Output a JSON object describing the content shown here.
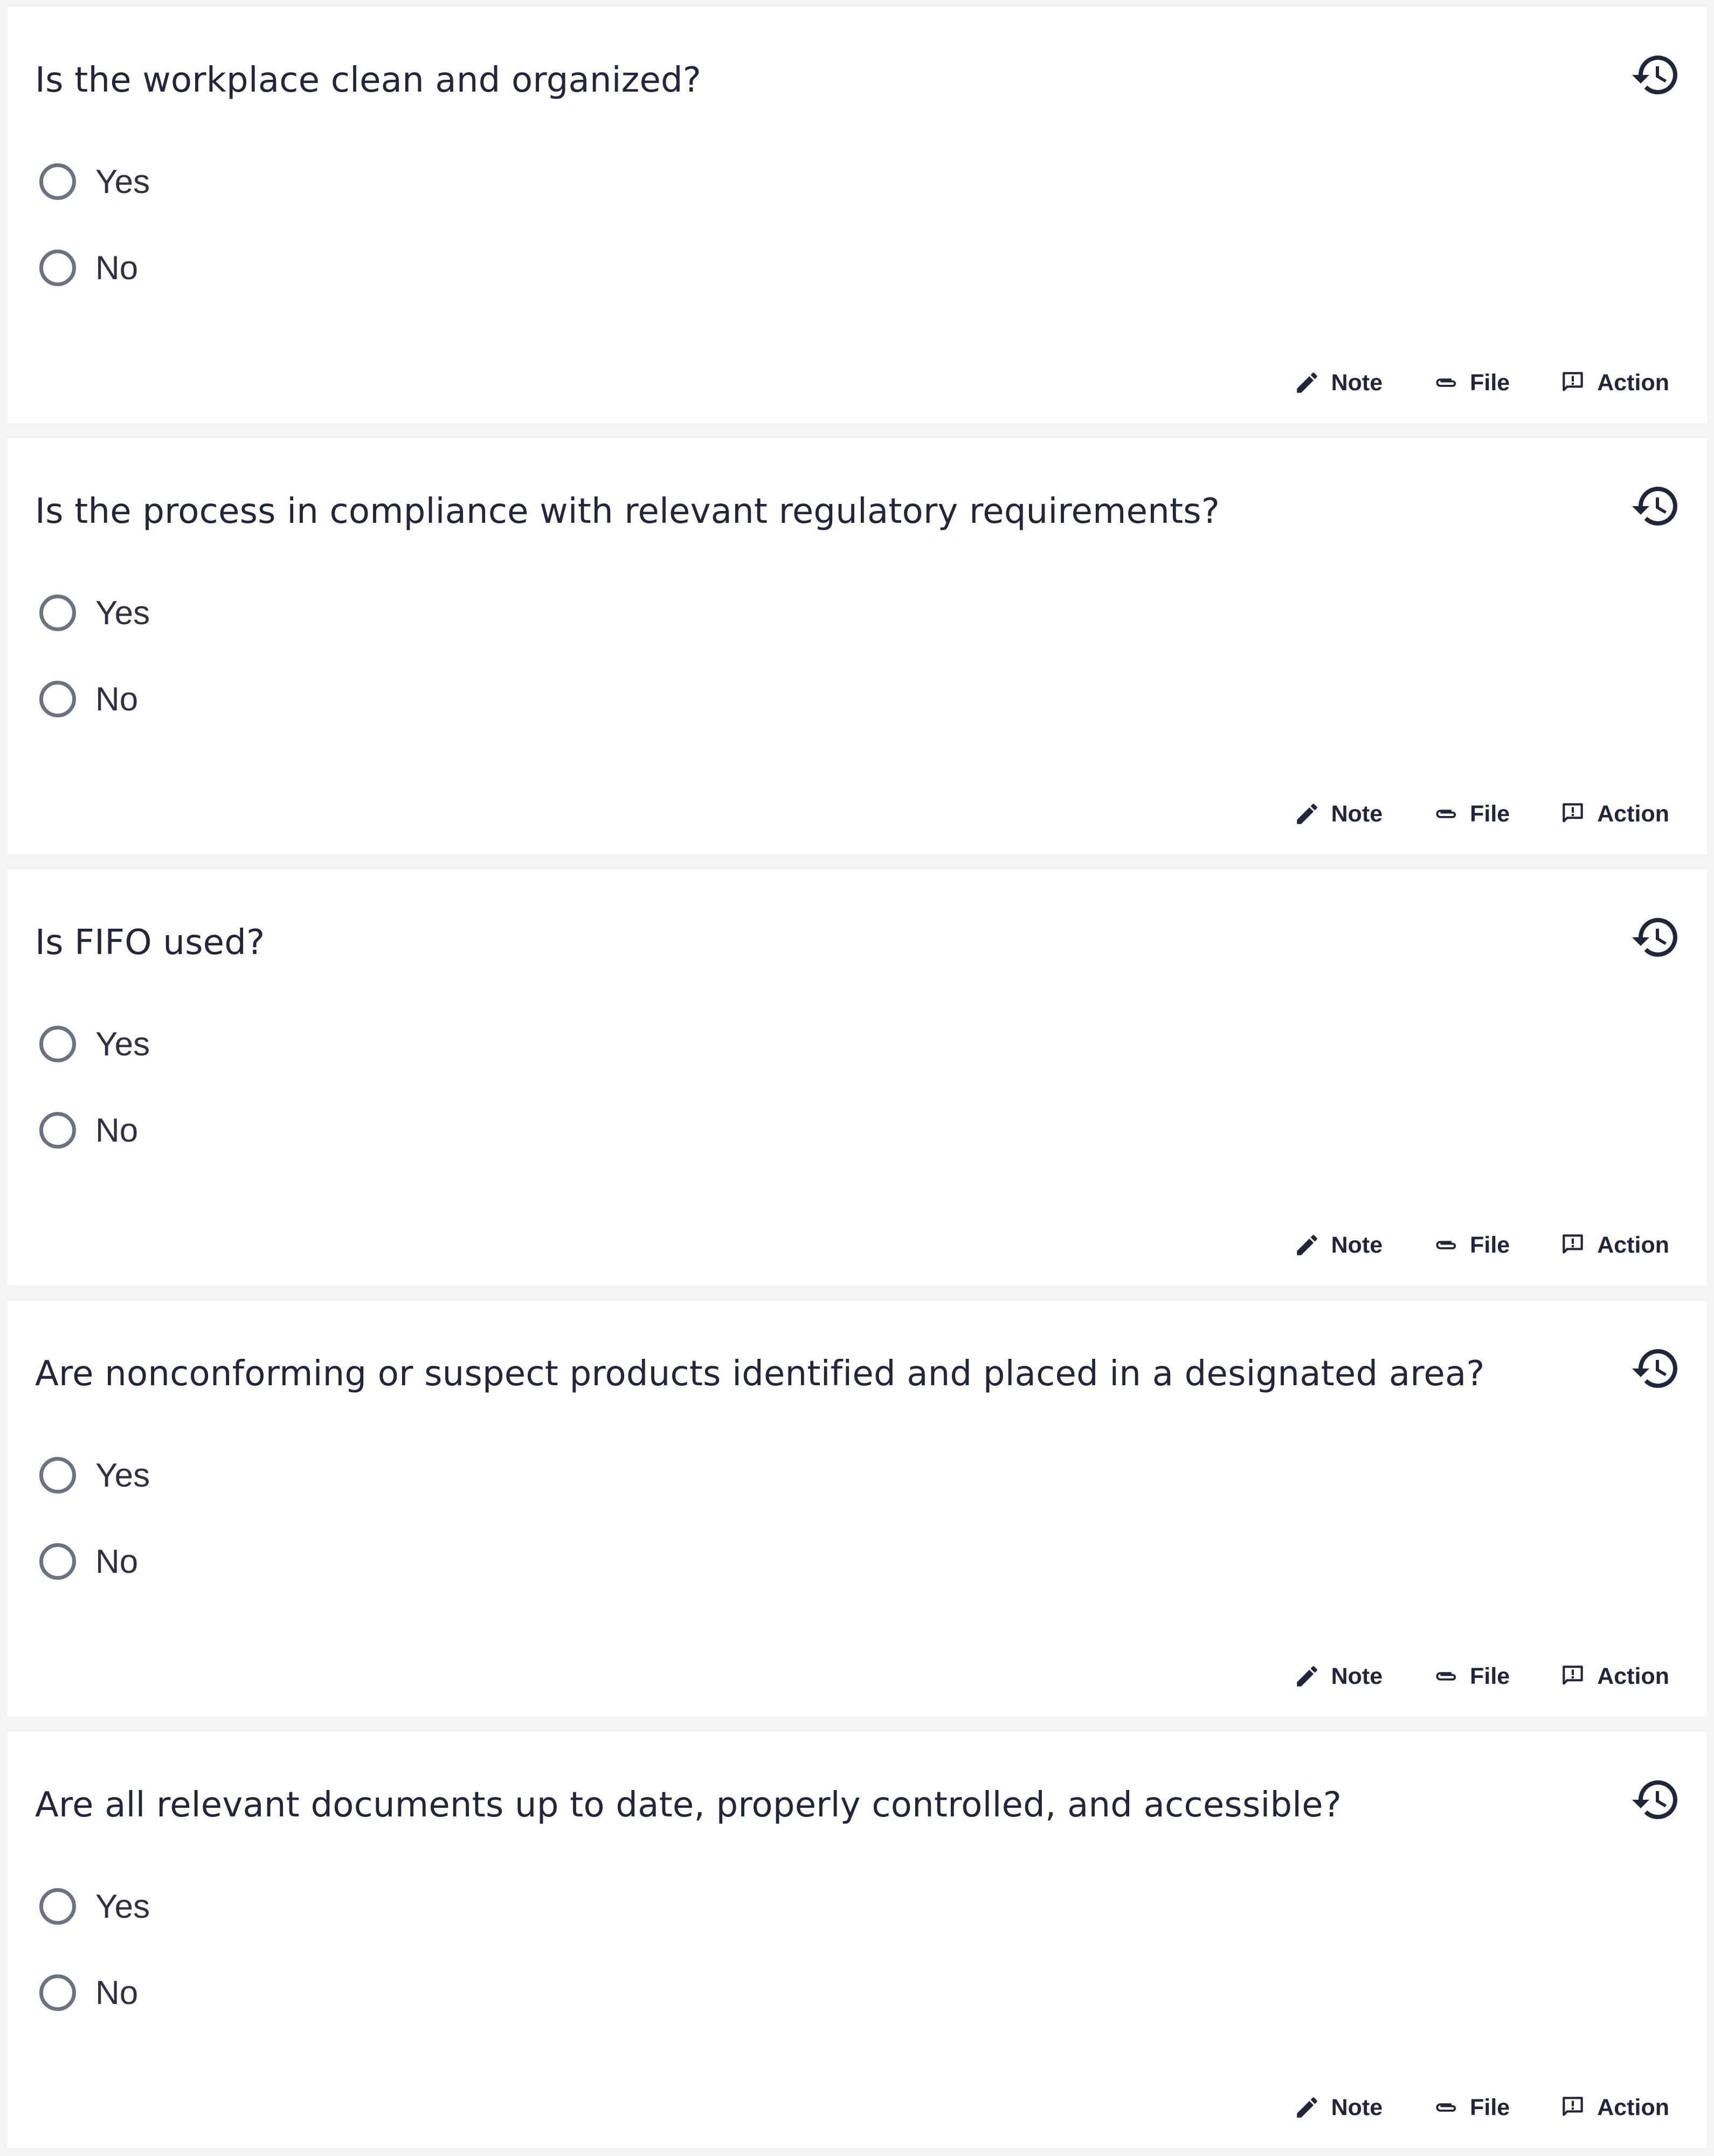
{
  "questions": [
    {
      "text": "Is the workplace clean and organized?",
      "options": [
        "Yes",
        "No"
      ],
      "actions": {
        "note": "Note",
        "file": "File",
        "action": "Action"
      }
    },
    {
      "text": "Is the process in compliance with relevant regulatory requirements?",
      "options": [
        "Yes",
        "No"
      ],
      "actions": {
        "note": "Note",
        "file": "File",
        "action": "Action"
      }
    },
    {
      "text": "Is FIFO used?",
      "options": [
        "Yes",
        "No"
      ],
      "actions": {
        "note": "Note",
        "file": "File",
        "action": "Action"
      }
    },
    {
      "text": "Are nonconforming or suspect products identified and placed in a designated area?",
      "options": [
        "Yes",
        "No"
      ],
      "actions": {
        "note": "Note",
        "file": "File",
        "action": "Action"
      }
    },
    {
      "text": "Are all relevant documents up to date, properly controlled, and accessible?",
      "options": [
        "Yes",
        "No"
      ],
      "actions": {
        "note": "Note",
        "file": "File",
        "action": "Action"
      }
    }
  ],
  "icons": {
    "history": "history-icon",
    "note": "pencil-icon",
    "file": "paperclip-icon",
    "action": "comment-exclamation-icon"
  },
  "colors": {
    "page_background": "#f3f4f6",
    "card_background": "#ffffff",
    "text": "#23253a",
    "radio_border": "#6b7280"
  }
}
